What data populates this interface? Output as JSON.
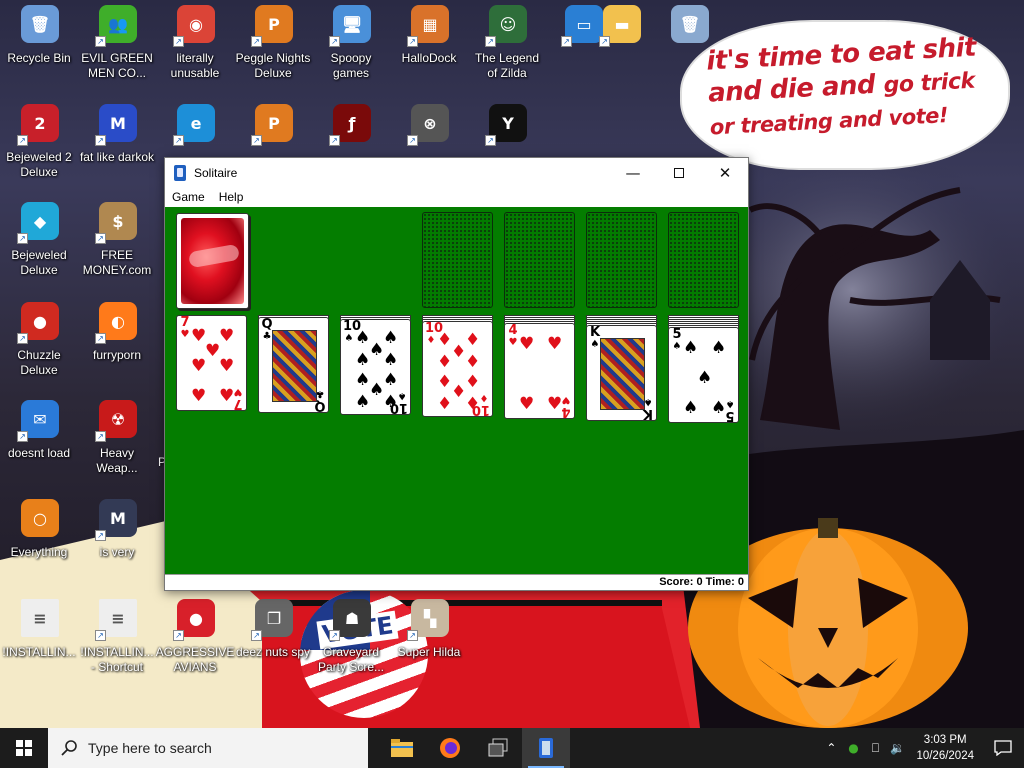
{
  "desktop": {
    "icons": [
      {
        "label": "Recycle Bin",
        "icon": "recycle-bin-icon",
        "color": "#6a9bd8",
        "glyph": "🗑"
      },
      {
        "label": "EVIL GREEN\nMEN CO...",
        "icon": "green-men-icon",
        "color": "#3fae2a",
        "glyph": "👥"
      },
      {
        "label": "literally\nunusable",
        "icon": "chrome-icon",
        "color": "#db4437",
        "glyph": "◉"
      },
      {
        "label": "Peggle Nights\nDeluxe",
        "icon": "peggle-icon",
        "color": "#e07a20",
        "glyph": "P"
      },
      {
        "label": "Spoopy\ngames",
        "icon": "network-computers-icon",
        "color": "#4a90d9",
        "glyph": "🖥"
      },
      {
        "label": "HalloDock",
        "icon": "hallodock-icon",
        "color": "#d9722a",
        "glyph": "▦"
      },
      {
        "label": "The Legend\nof Zilda",
        "icon": "zilda-icon",
        "color": "#2e6e3a",
        "glyph": "☺"
      },
      {
        "label": "",
        "icon": "windows-drive-icon",
        "color": "#2a7fd4",
        "glyph": "▭"
      },
      {
        "label": "",
        "icon": "folder-icon",
        "color": "#f2c14e",
        "glyph": "▬"
      },
      {
        "label": "",
        "icon": "recycle-bin-icon",
        "color": "#8aa9cf",
        "glyph": "🗑"
      },
      {
        "label": "Bejeweled 2\nDeluxe",
        "icon": "bejeweled2-icon",
        "color": "#c8202a",
        "glyph": "2"
      },
      {
        "label": "fat like darkok",
        "icon": "mpl-icon",
        "color": "#2a4cc8",
        "glyph": "M"
      },
      {
        "label": "",
        "icon": "edge-icon",
        "color": "#1d8fd8",
        "glyph": "e"
      },
      {
        "label": "",
        "icon": "peggle-icon",
        "color": "#e07a20",
        "glyph": "P"
      },
      {
        "label": "",
        "icon": "flash-icon",
        "color": "#7a0a0a",
        "glyph": "ƒ"
      },
      {
        "label": "",
        "icon": "uac-shield-icon",
        "color": "#555555",
        "glyph": "⊗"
      },
      {
        "label": "",
        "icon": "yashma-icon",
        "color": "#111111",
        "glyph": "Y"
      },
      {
        "label": "Bejeweled\nDeluxe",
        "icon": "bejeweled-icon",
        "color": "#20a8d8",
        "glyph": "◆"
      },
      {
        "label": "FREE\nMONEY.com",
        "icon": "money-bag-icon",
        "color": "#b08850",
        "glyph": "$"
      },
      {
        "label": "Chuzzle\nDeluxe",
        "icon": "chuzzle-icon",
        "color": "#d02a20",
        "glyph": "●"
      },
      {
        "label": "furryporn",
        "icon": "firefox-icon",
        "color": "#ff7a1a",
        "glyph": "◐"
      },
      {
        "label": "doesnt load",
        "icon": "thunderbird-icon",
        "color": "#2a7ad8",
        "glyph": "✉"
      },
      {
        "label": "Heavy\nWeap...",
        "icon": "radiation-icon",
        "color": "#c81a1a",
        "glyph": "☢"
      },
      {
        "label": "Everything",
        "icon": "everything-search-icon",
        "color": "#e8801a",
        "glyph": "○"
      },
      {
        "label": "is very",
        "icon": "mpl-shield-icon",
        "color": "#333a55",
        "glyph": "M"
      },
      {
        "label": "!INSTALLIN...",
        "icon": "text-file-icon",
        "color": "#eeeeee",
        "glyph": "≡"
      },
      {
        "label": "!INSTALLIN...\n- Shortcut",
        "icon": "text-file-icon",
        "color": "#eeeeee",
        "glyph": "≡"
      },
      {
        "label": "AGGRESSIVE\nAVIANS",
        "icon": "angry-bird-icon",
        "color": "#d8202a",
        "glyph": "●"
      },
      {
        "label": "deez nuts spy",
        "icon": "stack-windows-icon",
        "color": "#666666",
        "glyph": "❐"
      },
      {
        "label": "Graveyard\nParty Scre...",
        "icon": "graveyard-icon",
        "color": "#3a3a3a",
        "glyph": "☗"
      },
      {
        "label": "Super Hilda",
        "icon": "hilda-icon",
        "color": "#c8b8a0",
        "glyph": "▚"
      }
    ],
    "partial_label": "P"
  },
  "bubble": {
    "line1": "it's time to eat shit",
    "line2a": "and die and ",
    "line2b": "go trick",
    "line3": "or treating and vote!"
  },
  "vote_badge": "VOTE",
  "solitaire": {
    "title": "Solitaire",
    "menu": [
      "Game",
      "Help"
    ],
    "status": "Score: 0 Time: 0",
    "colors": {
      "felt": "#047d00",
      "red": "#e0101a"
    },
    "tableau": [
      {
        "rank": "7",
        "suit": "♥"
      },
      {
        "rank": "Q",
        "suit": "♣"
      },
      {
        "rank": "10",
        "suit": "♠"
      },
      {
        "rank": "10",
        "suit": "♦"
      },
      {
        "rank": "4",
        "suit": "♥"
      },
      {
        "rank": "K",
        "suit": "♠"
      },
      {
        "rank": "5",
        "suit": "♠"
      }
    ]
  },
  "taskbar": {
    "search_placeholder": "Type here to search",
    "time": "3:03 PM",
    "date": "10/26/2024"
  }
}
